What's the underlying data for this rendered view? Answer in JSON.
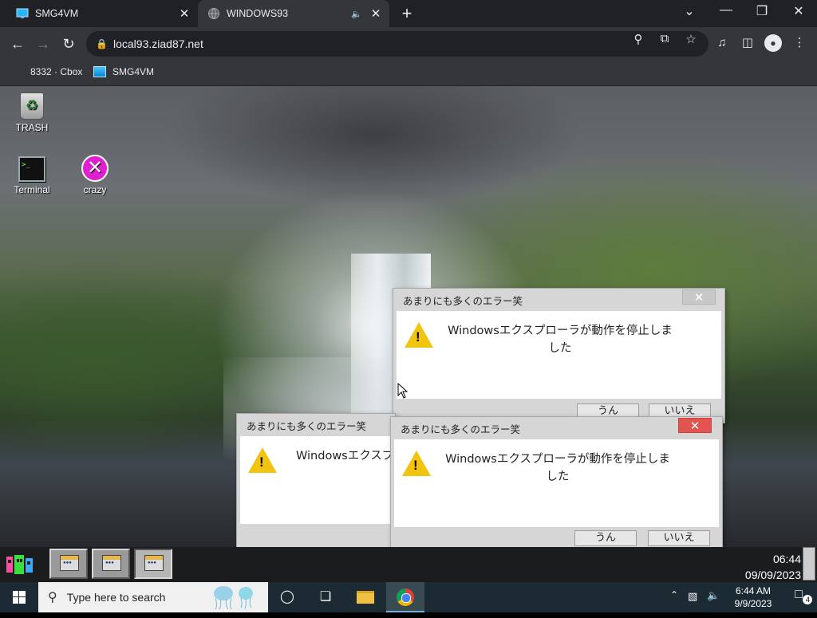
{
  "browser": {
    "tabs": [
      {
        "title": "SMG4VM",
        "close": "✕"
      },
      {
        "title": "WINDOWS93",
        "close": "✕",
        "audio": "🔈"
      }
    ],
    "new_tab": "+",
    "window_controls": {
      "dropdown": "⌄",
      "minimize": "—",
      "restore": "❐",
      "close": "✕"
    },
    "url": "local93.ziad87.net",
    "bookmarks": [
      {
        "label": "8332 · Cbox"
      },
      {
        "label": "SMG4VM"
      }
    ]
  },
  "desktop": {
    "icons": [
      {
        "label": "TRASH"
      },
      {
        "label": "Terminal"
      },
      {
        "label": "crazy"
      }
    ]
  },
  "dialogs": [
    {
      "title": "あまりにも多くのエラー笑",
      "message": "Windowsエクスプローラが動作を停止しました",
      "yes": "うん",
      "no": "いいえ",
      "close": "✕"
    },
    {
      "title": "あまりにも多くのエラー笑",
      "message": "Windowsエクスプ",
      "close": "✕"
    },
    {
      "title": "あまりにも多くのエラー笑",
      "message": "Windowsエクスプローラが動作を停止しました",
      "yes": "うん",
      "no": "いいえ",
      "close": "✕"
    }
  ],
  "w93_taskbar": {
    "time": "06:44",
    "date": "09/09/2023"
  },
  "windows_taskbar": {
    "search_placeholder": "Type here to search",
    "time": "6:44 AM",
    "date": "9/9/2023",
    "notification_count": "4"
  }
}
